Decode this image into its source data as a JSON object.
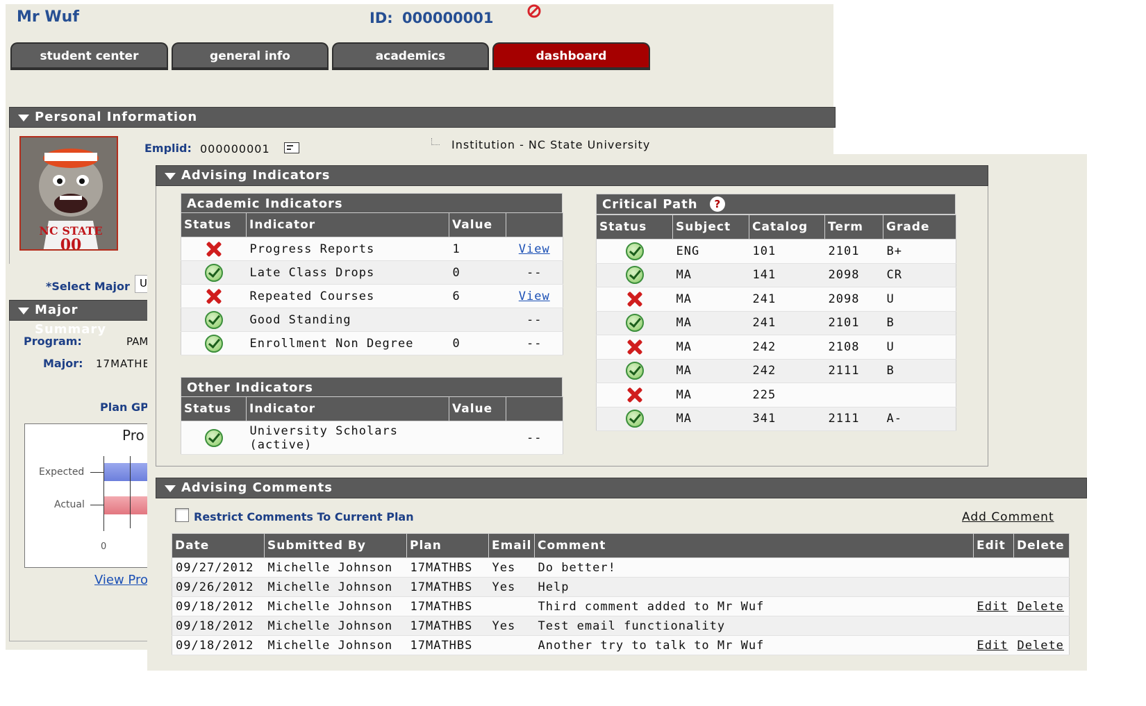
{
  "header": {
    "name": "Mr Wuf",
    "id_label": "ID:",
    "id_value": "000000001"
  },
  "tabs": [
    {
      "label": "student center",
      "active": false
    },
    {
      "label": "general info",
      "active": false
    },
    {
      "label": "academics",
      "active": false
    },
    {
      "label": "dashboard",
      "active": true
    }
  ],
  "personal": {
    "title": "Personal Information",
    "emplid_label": "Emplid:",
    "emplid_value": "000000001",
    "institution": "Institution - NC State University",
    "select_major_label": "*Select Major",
    "select_major_value": "U"
  },
  "major_summary": {
    "title": "Major Summary",
    "program_label": "Program:",
    "program_value": "PAM",
    "major_label": "Major:",
    "major_value": "17MATHE",
    "plan_gpa_label": "Plan GP",
    "chart_title": "Pro",
    "view_link": "View Pro"
  },
  "chart_data": {
    "type": "bar",
    "title": "Pro",
    "categories": [
      "Expected",
      "Actual"
    ],
    "tick_labels": [
      "0"
    ],
    "series": [
      {
        "values": [
          null,
          null
        ]
      }
    ],
    "colors": [
      "#7c8de0",
      "#ea8f96"
    ]
  },
  "advising_indicators": {
    "title": "Advising Indicators",
    "academic": {
      "title": "Academic Indicators",
      "columns": [
        "Status",
        "Indicator",
        "Value",
        ""
      ],
      "rows": [
        {
          "status": "fail",
          "indicator": "Progress Reports",
          "value": "1",
          "action": "View"
        },
        {
          "status": "ok",
          "indicator": "Late Class Drops",
          "value": "0",
          "action": "--"
        },
        {
          "status": "fail",
          "indicator": "Repeated Courses",
          "value": "6",
          "action": "View"
        },
        {
          "status": "ok",
          "indicator": "Good Standing",
          "value": "",
          "action": "--"
        },
        {
          "status": "ok",
          "indicator": "Enrollment Non Degree",
          "value": "0",
          "action": "--"
        }
      ]
    },
    "other": {
      "title": "Other Indicators",
      "columns": [
        "Status",
        "Indicator",
        "Value",
        ""
      ],
      "rows": [
        {
          "status": "ok",
          "indicator_line1": "University Scholars",
          "indicator_line2": "(active)",
          "value": "",
          "action": "--"
        }
      ]
    },
    "critical_path": {
      "title": "Critical Path",
      "help": "?",
      "columns": [
        "Status",
        "Subject",
        "Catalog",
        "Term",
        "Grade"
      ],
      "rows": [
        {
          "status": "ok",
          "subject": "ENG",
          "catalog": "101",
          "term": "2101",
          "grade": "B+"
        },
        {
          "status": "ok",
          "subject": "MA",
          "catalog": "141",
          "term": "2098",
          "grade": "CR"
        },
        {
          "status": "fail",
          "subject": "MA",
          "catalog": "241",
          "term": "2098",
          "grade": "U"
        },
        {
          "status": "ok",
          "subject": "MA",
          "catalog": "241",
          "term": "2101",
          "grade": "B"
        },
        {
          "status": "fail",
          "subject": "MA",
          "catalog": "242",
          "term": "2108",
          "grade": "U"
        },
        {
          "status": "ok",
          "subject": "MA",
          "catalog": "242",
          "term": "2111",
          "grade": "B"
        },
        {
          "status": "fail",
          "subject": "MA",
          "catalog": "225",
          "term": "",
          "grade": ""
        },
        {
          "status": "ok",
          "subject": "MA",
          "catalog": "341",
          "term": "2111",
          "grade": "A-"
        }
      ]
    }
  },
  "comments": {
    "title": "Advising Comments",
    "restrict_label": "Restrict Comments To Current Plan",
    "add_label": "Add Comment",
    "columns": [
      "Date",
      "Submitted By",
      "Plan",
      "Email",
      "Comment",
      "Edit",
      "Delete"
    ],
    "rows": [
      {
        "date": "09/27/2012",
        "by": "Michelle Johnson",
        "plan": "17MATHBS",
        "email": "Yes",
        "comment": "Do better!",
        "edit": "",
        "delete": ""
      },
      {
        "date": "09/26/2012",
        "by": "Michelle Johnson",
        "plan": "17MATHBS",
        "email": "Yes",
        "comment": "Help",
        "edit": "",
        "delete": ""
      },
      {
        "date": "09/18/2012",
        "by": "Michelle Johnson",
        "plan": "17MATHBS",
        "email": "",
        "comment": "Third comment added to Mr Wuf",
        "edit": "Edit",
        "delete": "Delete"
      },
      {
        "date": "09/18/2012",
        "by": "Michelle Johnson",
        "plan": "17MATHBS",
        "email": "Yes",
        "comment": "Test email functionality",
        "edit": "",
        "delete": ""
      },
      {
        "date": "09/18/2012",
        "by": "Michelle Johnson",
        "plan": "17MATHBS",
        "email": "",
        "comment": "Another try to talk to Mr Wuf",
        "edit": "Edit",
        "delete": "Delete"
      }
    ]
  }
}
